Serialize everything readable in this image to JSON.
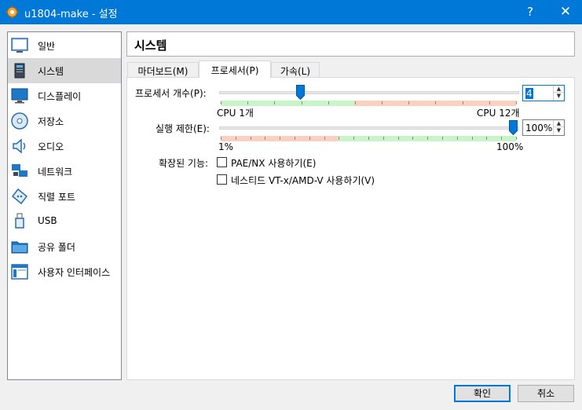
{
  "window": {
    "title": "u1804-make - 설정",
    "help_label": "?",
    "close_label": "✕"
  },
  "sidebar": {
    "items": [
      {
        "label": "일반",
        "icon": "general-icon"
      },
      {
        "label": "시스템",
        "icon": "system-icon",
        "selected": true
      },
      {
        "label": "디스플레이",
        "icon": "display-icon"
      },
      {
        "label": "저장소",
        "icon": "storage-icon"
      },
      {
        "label": "오디오",
        "icon": "audio-icon"
      },
      {
        "label": "네트워크",
        "icon": "network-icon"
      },
      {
        "label": "직렬 포트",
        "icon": "serial-port-icon"
      },
      {
        "label": "USB",
        "icon": "usb-icon"
      },
      {
        "label": "공유 폴더",
        "icon": "shared-folder-icon"
      },
      {
        "label": "사용자 인터페이스",
        "icon": "user-interface-icon"
      }
    ]
  },
  "header": {
    "title": "시스템"
  },
  "tabs": [
    {
      "label": "마더보드(M)"
    },
    {
      "label": "프로세서(P)",
      "active": true
    },
    {
      "label": "가속(L)"
    }
  ],
  "processor": {
    "count_label": "프로세서 개수(P):",
    "count_value": "4",
    "count_fraction": 0.27,
    "min_label": "CPU 1개",
    "max_label": "CPU 12개",
    "cap_label": "실행 제한(E):",
    "cap_value": "100%",
    "cap_fraction": 1.0,
    "cap_min_label": "1%",
    "cap_max_label": "100%",
    "features_label": "확장된 기능:",
    "pae_label": "PAE/NX 사용하기(E)",
    "pae_checked": false,
    "vtx_label": "네스티드 VT-x/AMD-V 사용하기(V)",
    "vtx_checked": false
  },
  "buttons": {
    "ok": "확인",
    "cancel": "취소"
  },
  "colors": {
    "titlebar": "#0078d7",
    "accent": "#0078d7",
    "zone_green": "#c8f5c8",
    "zone_red": "#fbd0c0"
  }
}
